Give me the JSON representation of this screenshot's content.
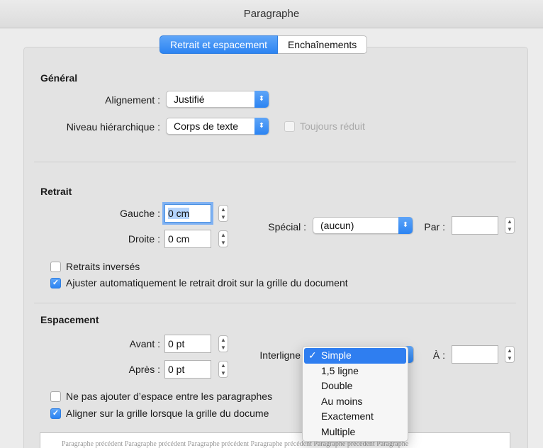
{
  "window": {
    "title": "Paragraphe"
  },
  "tabs": [
    {
      "label": "Retrait et espacement"
    },
    {
      "label": "Enchaînements"
    }
  ],
  "general": {
    "heading": "Général",
    "alignment_label": "Alignement :",
    "alignment_value": "Justifié",
    "level_label": "Niveau hiérarchique :",
    "level_value": "Corps de texte",
    "collapsed_label": "Toujours réduit"
  },
  "indent": {
    "heading": "Retrait",
    "left_label": "Gauche :",
    "left_value": "0 cm",
    "right_label": "Droite :",
    "right_value": "0 cm",
    "special_label": "Spécial :",
    "special_value": "(aucun)",
    "by_label": "Par :",
    "by_value": "",
    "mirror_label": "Retraits inversés",
    "auto_adjust_label": "Ajuster automatiquement le retrait droit sur la grille du document"
  },
  "spacing": {
    "heading": "Espacement",
    "before_label": "Avant :",
    "before_value": "0 pt",
    "after_label": "Après :",
    "after_value": "0 pt",
    "line_label": "Interligne",
    "at_label": "À :",
    "at_value": "",
    "no_space_label": "Ne pas ajouter d’espace entre les paragraphes",
    "snap_grid_label": "Aligner sur la grille lorsque la grille du docume"
  },
  "line_spacing_menu": {
    "selected": "Simple",
    "items": [
      "Simple",
      "1,5 ligne",
      "Double",
      "Au moins",
      "Exactement",
      "Multiple"
    ]
  },
  "preview": {
    "text": "Paragraphe précédent Paragraphe précédent Paragraphe précédent Paragraphe précédent Paragraphe précédent Paragraphe"
  },
  "colors": {
    "accent": "#2c84f2",
    "background": "#ececec",
    "panel": "#e3e3e3"
  }
}
